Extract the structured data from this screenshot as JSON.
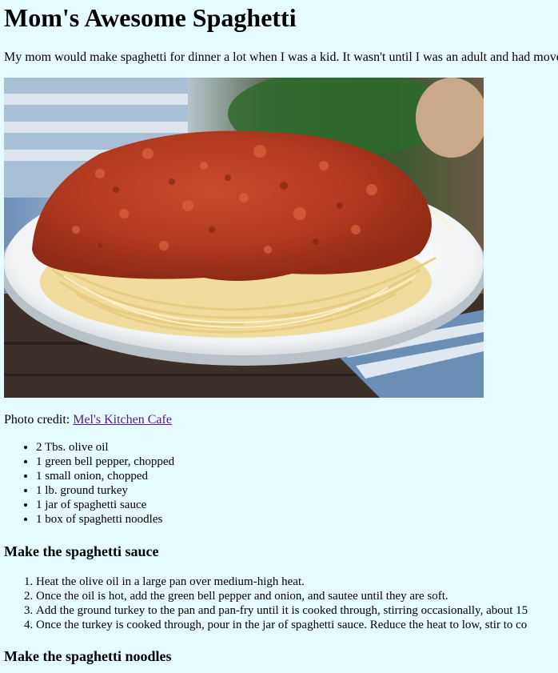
{
  "title": "Mom's Awesome Spaghetti",
  "intro": "My mom would make spaghetti for dinner a lot when I was a kid. It wasn't until I was an adult and had moved",
  "photo": {
    "alt": "Spaghetti with meat sauce on a white plate"
  },
  "credit": {
    "label": "Photo credit: ",
    "link_text": "Mel's Kitchen Cafe"
  },
  "ingredients": [
    "2 Tbs. olive oil",
    "1 green bell pepper, chopped",
    "1 small onion, chopped",
    "1 lb. ground turkey",
    "1 jar of spaghetti sauce",
    "1 box of spaghetti noodles"
  ],
  "sections": {
    "sauce_heading": "Make the spaghetti sauce",
    "noodles_heading": "Make the spaghetti noodles"
  },
  "sauce_steps": [
    "Heat the olive oil in a large pan over medium-high heat.",
    "Once the oil is hot, add the green bell pepper and onion, and sautee until they are soft.",
    "Add the ground turkey to the pan and pan-fry until it is cooked through, stirring occasionally, about 15",
    "Once the turkey is cooked through, pour in the jar of spaghetti sauce. Reduce the heat to low, stir to co"
  ],
  "colors": {
    "background": "#e6fbff",
    "visited_link": "#551a8b",
    "sauce": "#b5361f",
    "noodles": "#f3e3a6"
  }
}
